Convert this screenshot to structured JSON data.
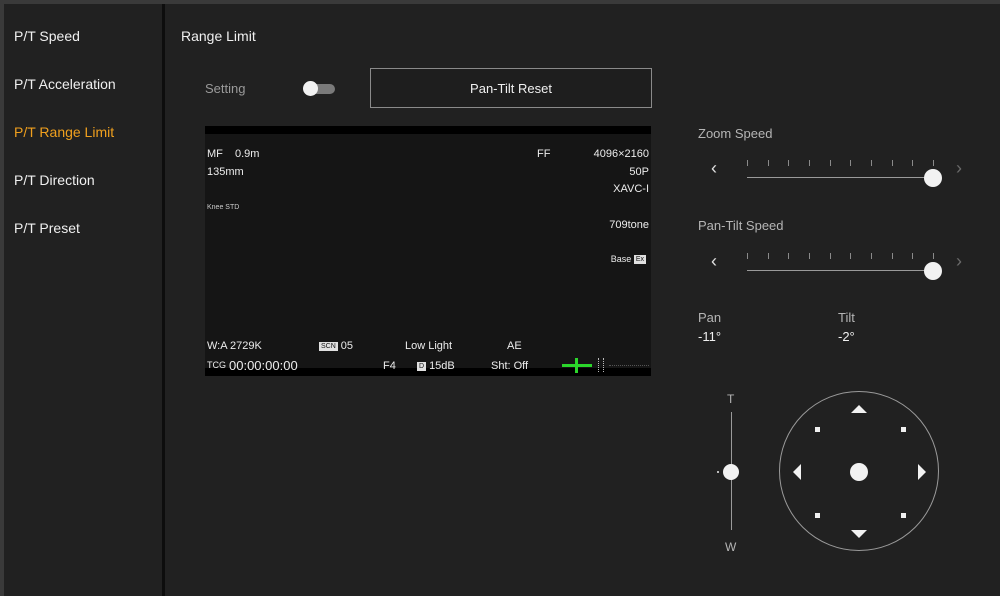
{
  "sidebar": {
    "items": [
      {
        "label": "P/T Speed"
      },
      {
        "label": "P/T Acceleration"
      },
      {
        "label": "P/T Range Limit"
      },
      {
        "label": "P/T Direction"
      },
      {
        "label": "P/T Preset"
      }
    ],
    "active_index": 2
  },
  "main": {
    "title": "Range Limit",
    "setting_label": "Setting",
    "setting_on": false,
    "reset_button": "Pan-Tilt Reset"
  },
  "monitor": {
    "focus_mode": "MF",
    "focus_distance": "0.9m",
    "focal_length": "135mm",
    "knee": "Knee STD",
    "format": "FF",
    "resolution": "4096×2160",
    "frame_rate": "50P",
    "codec": "XAVC-I",
    "gamma": "709tone",
    "base_badge": "Ex",
    "base": "Base",
    "wb": "W:A  2729K",
    "scene_icon": "SCN",
    "scene_value": "05",
    "low_light": "Low Light",
    "ae": "AE",
    "tc": "TCG",
    "timecode": "00:00:00:00",
    "iris": "F4",
    "gain_icon": "D",
    "gain": "15dB",
    "shutter": "Sht: Off",
    "level_color": "#2bd62b"
  },
  "zoom_speed": {
    "label": "Zoom Speed",
    "value": 1.0
  },
  "pan_tilt_speed": {
    "label": "Pan-Tilt Speed",
    "value": 1.0
  },
  "pan": {
    "label": "Pan",
    "value": "-11°"
  },
  "tilt": {
    "label": "Tilt",
    "value": "-2°"
  },
  "zoom": {
    "tele_label": "T",
    "wide_label": "W"
  },
  "colors": {
    "accent": "#f0a01e",
    "background": "#212121"
  }
}
